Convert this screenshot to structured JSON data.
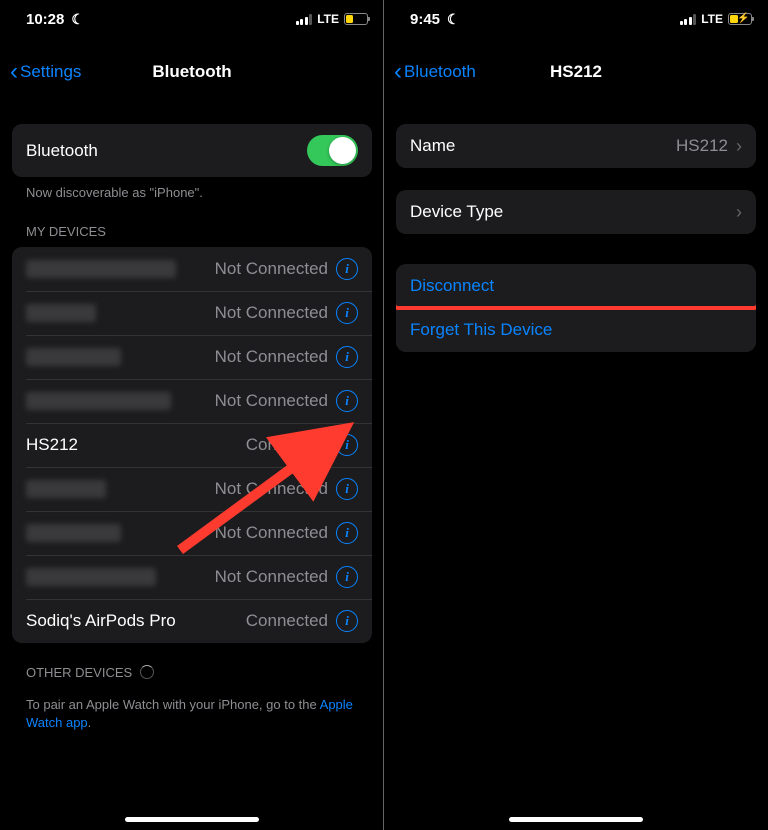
{
  "left": {
    "status": {
      "time": "10:28",
      "network": "LTE"
    },
    "nav": {
      "back_label": "Settings",
      "title": "Bluetooth"
    },
    "bluetooth_row": {
      "label": "Bluetooth"
    },
    "discoverable_text": "Now discoverable as \"iPhone\".",
    "my_devices_header": "MY DEVICES",
    "devices": [
      {
        "name_hidden": true,
        "name": "",
        "status": "Not Connected"
      },
      {
        "name_hidden": true,
        "name": "",
        "status": "Not Connected"
      },
      {
        "name_hidden": true,
        "name": "",
        "status": "Not Connected"
      },
      {
        "name_hidden": true,
        "name": "",
        "status": "Not Connected"
      },
      {
        "name_hidden": false,
        "name": "HS212",
        "status": "Connected"
      },
      {
        "name_hidden": true,
        "name": "",
        "status": "Not Connected"
      },
      {
        "name_hidden": true,
        "name": "",
        "status": "Not Connected"
      },
      {
        "name_hidden": true,
        "name": "",
        "status": "Not Connected"
      },
      {
        "name_hidden": false,
        "name": "Sodiq's AirPods Pro",
        "status": "Connected"
      }
    ],
    "other_devices_header": "OTHER DEVICES",
    "apple_watch_hint_prefix": "To pair an Apple Watch with your iPhone, go to the ",
    "apple_watch_link": "Apple Watch app",
    "apple_watch_hint_suffix": "."
  },
  "right": {
    "status": {
      "time": "9:45",
      "network": "LTE"
    },
    "nav": {
      "back_label": "Bluetooth",
      "title": "HS212"
    },
    "name_row": {
      "label": "Name",
      "value": "HS212"
    },
    "device_type_row": {
      "label": "Device Type"
    },
    "disconnect_label": "Disconnect",
    "forget_label": "Forget This Device"
  }
}
